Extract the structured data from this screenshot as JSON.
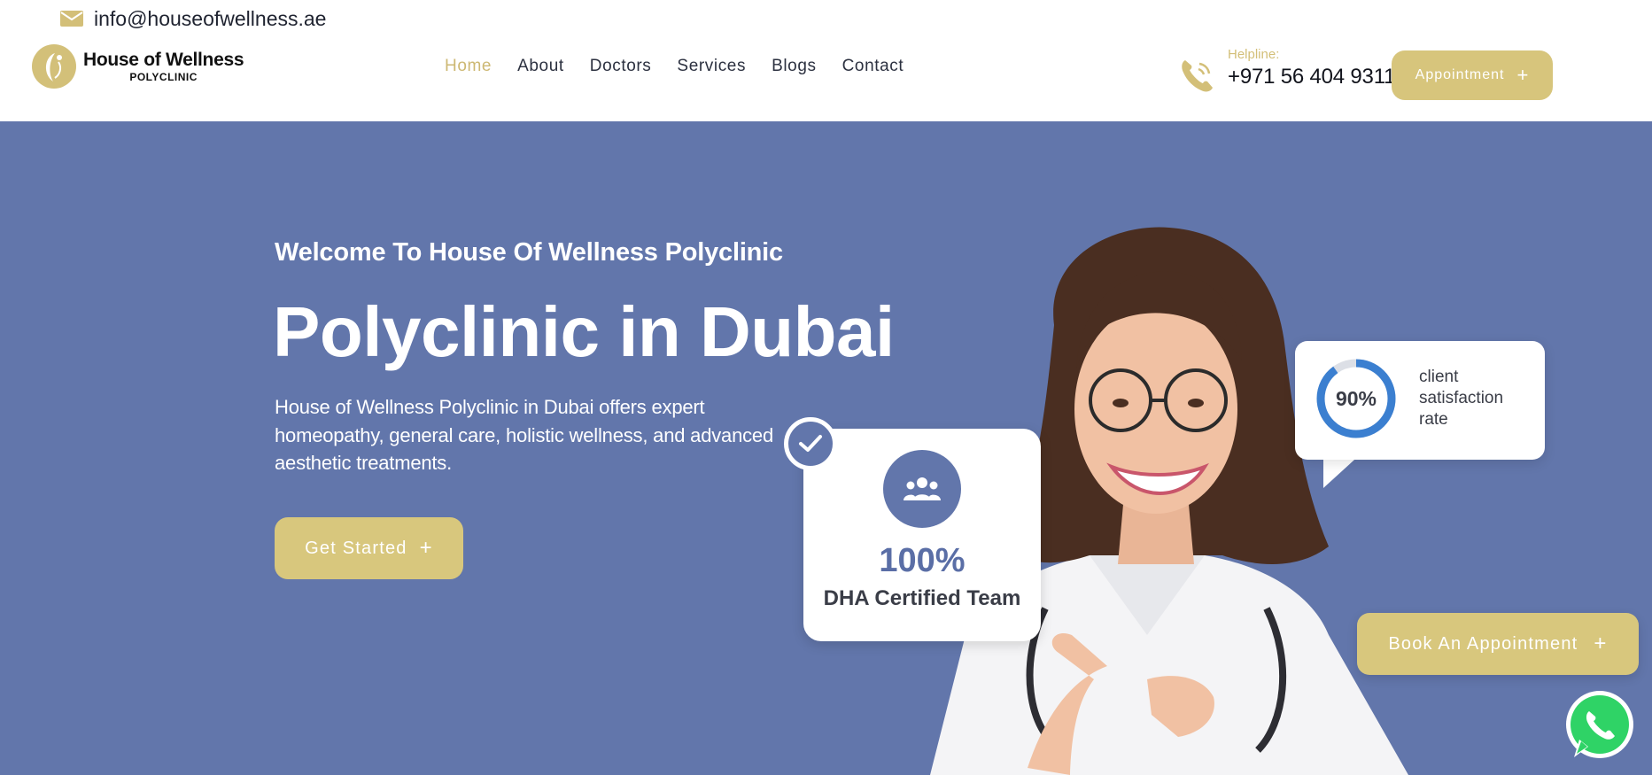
{
  "topbar": {
    "email": "info@houseofwellness.ae",
    "email_icon": "mail-icon"
  },
  "logo": {
    "title": "House of Wellness",
    "subtitle": "POLYCLINIC"
  },
  "nav": {
    "items": [
      {
        "label": "Home",
        "active": true
      },
      {
        "label": "About"
      },
      {
        "label": "Doctors"
      },
      {
        "label": "Services"
      },
      {
        "label": "Blogs"
      },
      {
        "label": "Contact"
      }
    ]
  },
  "helpline": {
    "label": "Helpline:",
    "number": "+971 56 404 9311",
    "icon": "phone-icon"
  },
  "header_button": {
    "label": "Appointment",
    "icon": "+"
  },
  "hero": {
    "kicker": "Welcome To House Of Wellness Polyclinic",
    "title": "Polyclinic in Dubai",
    "description": "House of Wellness Polyclinic in Dubai offers expert homeopathy, general care, holistic wellness, and advanced aesthetic treatments.",
    "cta_label": "Get Started",
    "cta_icon": "+"
  },
  "dha_card": {
    "value": "100%",
    "label": "DHA Certified Team",
    "icons": [
      "check-icon",
      "team-icon"
    ]
  },
  "satisfaction_card": {
    "value": "90%",
    "label": "client satisfaction rate",
    "progress": 0.9
  },
  "floating_button": {
    "label": "Book An Appointment",
    "icon": "+"
  },
  "whatsapp": {
    "icon": "whatsapp-icon"
  },
  "colors": {
    "gold": "#d7c57c",
    "hero_blue": "#6276ab",
    "nav_active": "#cdb873",
    "text_dark": "#2c3140"
  }
}
